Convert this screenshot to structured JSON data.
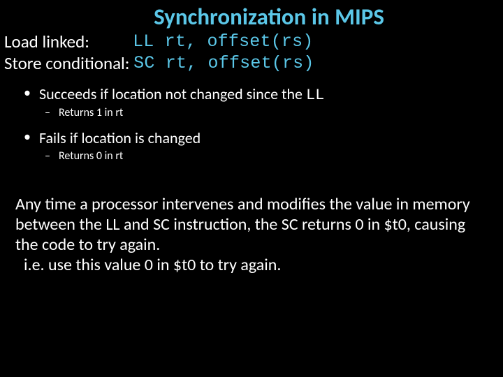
{
  "title": "Synchronization in MIPS",
  "defs": {
    "row1_label": "Load linked:           ",
    "row1_code": "LL rt, offset(rs)",
    "row2_label": "Store conditional: ",
    "row2_code": "SC rt, offset(rs)"
  },
  "bullets": {
    "b1a_pre": "Succeeds if location not changed since the ",
    "b1a_code": "LL",
    "b1a_sub": "Returns 1 in rt",
    "b1b": "Fails if location is changed",
    "b1b_sub": "Returns 0 in rt"
  },
  "para": {
    "p1": "Any time a processor intervenes and modifies the value in memory between the LL and SC instruction, the SC returns 0 in $t0, causing the code to try again.",
    "p2": "i.e. use this value 0 in $t0 to try again."
  }
}
